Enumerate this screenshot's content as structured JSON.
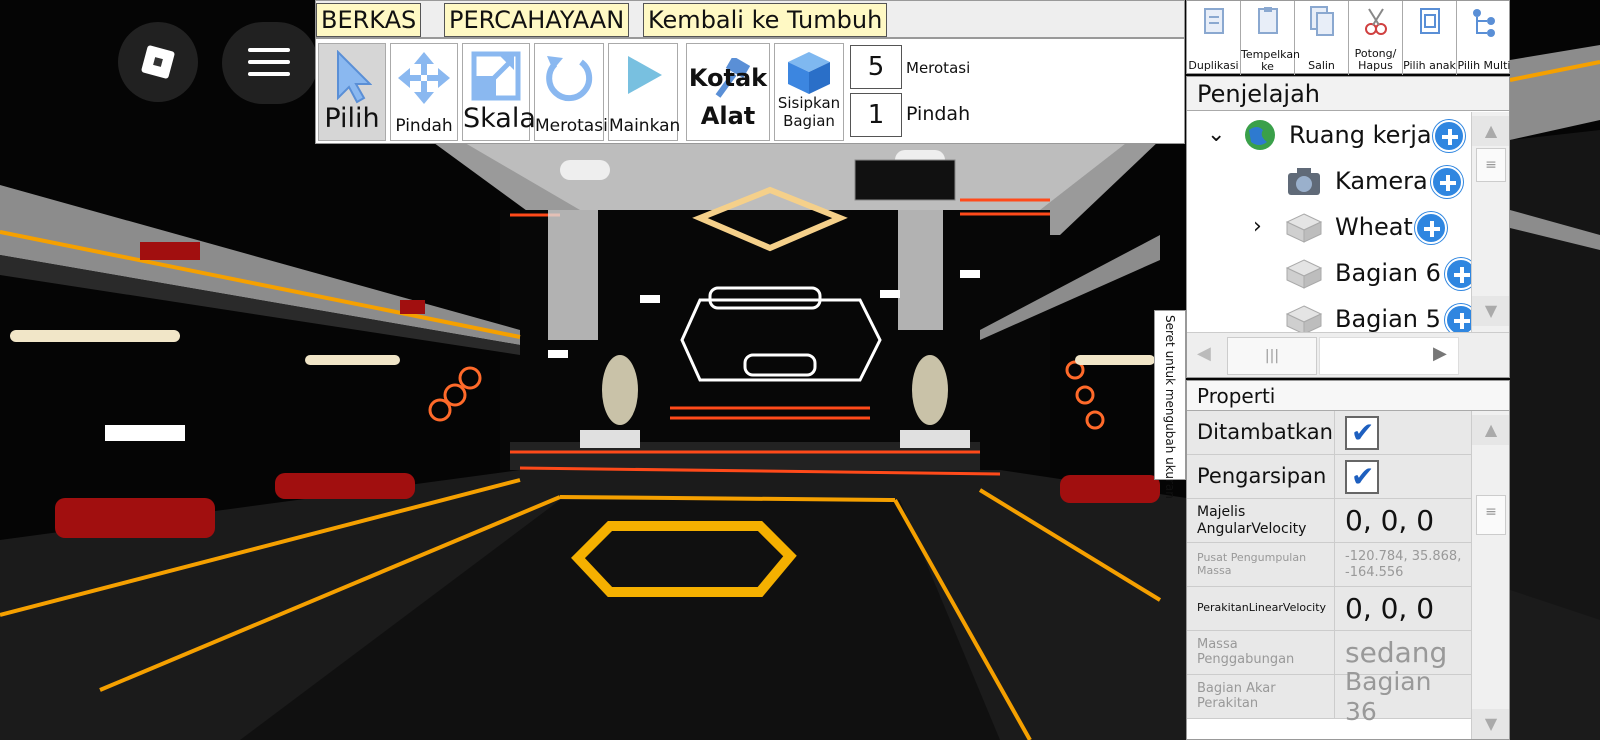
{
  "tabs": [
    {
      "label": "BERKAS"
    },
    {
      "label": "PERCAHAYAAN"
    },
    {
      "label": "Kembali ke Tumbuh"
    }
  ],
  "tools": {
    "select": "Pilih",
    "move": "Pindah",
    "scale": "Skala",
    "rotate": "Merotasi",
    "play": "Mainkan",
    "toolbox_line1": "Kotak",
    "toolbox_line2": "Alat",
    "insert_part": "Sisipkan Bagian",
    "rotate_step": {
      "value": "5",
      "label": "Merotasi"
    },
    "move_step": {
      "value": "1",
      "label": "Pindah"
    }
  },
  "actions": [
    {
      "label": "Duplikasi",
      "icon": "duplicate-icon"
    },
    {
      "label": "Tempelkan ke",
      "icon": "paste-into-icon"
    },
    {
      "label": "Salin",
      "icon": "copy-icon"
    },
    {
      "label": "Potong/ Hapus",
      "icon": "cut-icon"
    },
    {
      "label": "Pilih anak",
      "icon": "select-children-icon"
    },
    {
      "label": "Pilih Multi",
      "icon": "multi-select-icon"
    }
  ],
  "explorer": {
    "title": "Penjelajah",
    "items": [
      {
        "label": "Ruang kerja",
        "icon": "workspace-globe-icon",
        "expanded": true
      },
      {
        "label": "Kamera",
        "icon": "camera-icon"
      },
      {
        "label": "Wheat",
        "icon": "model-brick-icon",
        "expanded": false
      },
      {
        "label": "Bagian 6",
        "icon": "part-brick-icon"
      },
      {
        "label": "Bagian 5",
        "icon": "part-brick-icon"
      }
    ]
  },
  "resize_hint": "Seret untuk mengubah ukuran",
  "properties": {
    "title": "Properti",
    "rows": [
      {
        "name": "Ditambatkan",
        "value": true
      },
      {
        "name": "Pengarsipan",
        "value": true
      },
      {
        "name": "Majelis AngularVelocity",
        "value": "0, 0, 0"
      },
      {
        "name": "Pusat Pengumpulan Massa",
        "value": "-120.784, 35.868, -164.556"
      },
      {
        "name": "PerakitanLinearVelocity",
        "value": "0, 0, 0"
      },
      {
        "name": "Massa Penggabungan",
        "value": "sedang"
      },
      {
        "name": "Bagian Akar Perakitan",
        "value": "Bagian 36"
      }
    ]
  },
  "colors": {
    "accent_orange": "#f5a000",
    "neon_red": "#ff4a1a",
    "plus_blue": "#2f86e0",
    "tab_yellow": "#fff9c4"
  }
}
